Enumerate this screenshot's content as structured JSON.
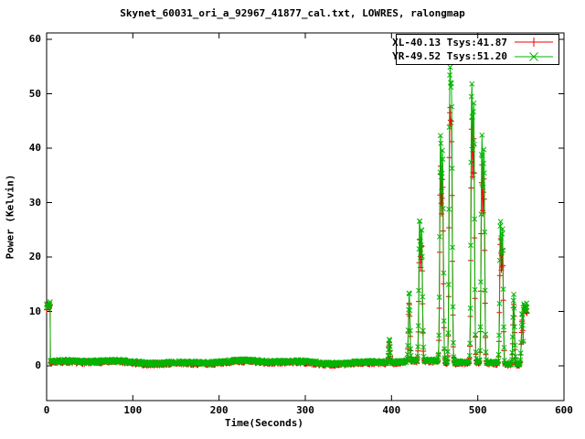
{
  "window": {
    "background": "#ffffff",
    "kind": "gnuplot-plot-window"
  },
  "chart_data": {
    "type": "line",
    "title": "Skynet_60031_ori_a_92967_41877_cal.txt, LOWRES, ralongmap",
    "xlabel": "Time(Seconds)",
    "ylabel": "Power (Kelvin)",
    "xlim": [
      0,
      600
    ],
    "ylim": [
      0,
      60
    ],
    "xticks": [
      0,
      100,
      200,
      300,
      400,
      500,
      600
    ],
    "yticks": [
      0,
      10,
      20,
      30,
      40,
      50,
      60
    ],
    "grid": false,
    "legend_position": "top-right-inside-box",
    "axis_color": "#000000",
    "sample_step_seconds": 0.45,
    "data_end_seconds": 557.5,
    "description": "Radio telescope calibrated power vs time: cal block ~11K at t=0-4, noisy ~0.7K baseline, source-crossing spikes between t=395-552, end cal knot ~11K at t=553-557.",
    "series": [
      {
        "name": "XL-40.13 Tsys:41.87",
        "color": "#ee0000",
        "marker": "plus",
        "seed": 7,
        "baseline_level": 0.55,
        "noise_amplitude": 0.6,
        "start_cal": {
          "t_start": 0,
          "t_end": 4.2,
          "level": 10.9
        },
        "end_cal": {
          "t_start": 553,
          "level": 10.4
        },
        "peak_sigma_seconds": 1.25,
        "peaks": [
          [
            397.5,
            3.6
          ],
          [
            420.5,
            11.2
          ],
          [
            432.6,
            22.5
          ],
          [
            435.0,
            21.0
          ],
          [
            456.8,
            35.5
          ],
          [
            459.2,
            33.0
          ],
          [
            467.6,
            43.5
          ],
          [
            469.6,
            40.0
          ],
          [
            493.0,
            44.0
          ],
          [
            495.4,
            40.5
          ],
          [
            504.8,
            35.5
          ],
          [
            507.2,
            33.0
          ],
          [
            526.3,
            22.5
          ],
          [
            528.7,
            21.0
          ],
          [
            541.7,
            11.0
          ],
          [
            551.5,
            8.3
          ]
        ]
      },
      {
        "name": "YR-49.52 Tsys:51.20",
        "color": "#00b400",
        "marker": "cross",
        "seed": 13,
        "baseline_level": 0.7,
        "noise_amplitude": 0.6,
        "start_cal": {
          "t_start": 0,
          "t_end": 4.2,
          "level": 11.3
        },
        "end_cal": {
          "t_start": 553,
          "level": 10.8
        },
        "peak_sigma_seconds": 1.25,
        "peaks": [
          [
            397.5,
            4.2
          ],
          [
            420.5,
            12.8
          ],
          [
            432.6,
            25.8
          ],
          [
            435.0,
            24.0
          ],
          [
            456.8,
            40.8
          ],
          [
            459.2,
            38.0
          ],
          [
            467.6,
            49.8
          ],
          [
            469.6,
            46.0
          ],
          [
            493.0,
            50.5
          ],
          [
            495.4,
            46.5
          ],
          [
            504.8,
            40.8
          ],
          [
            507.2,
            38.0
          ],
          [
            526.3,
            25.8
          ],
          [
            528.7,
            24.0
          ],
          [
            541.7,
            12.6
          ],
          [
            551.5,
            9.5
          ]
        ]
      }
    ]
  }
}
